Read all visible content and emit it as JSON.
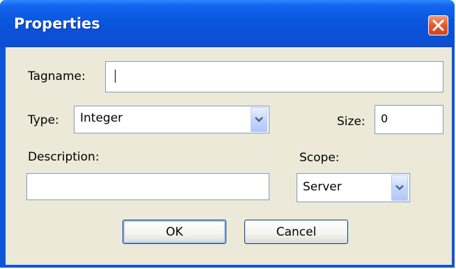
{
  "window": {
    "title": "Properties"
  },
  "fields": {
    "tagname_label": "Tagname:",
    "tagname_value": "",
    "type_label": "Type:",
    "type_value": "Integer",
    "size_label": "Size:",
    "size_value": "0",
    "description_label": "Description:",
    "description_value": "",
    "scope_label": "Scope:",
    "scope_value": "Server"
  },
  "buttons": {
    "ok": "OK",
    "cancel": "Cancel"
  },
  "icons": {
    "close": "close-icon",
    "dropdown": "chevron-down-icon"
  },
  "colors": {
    "titlebar": "#0a56de",
    "close": "#e2552b",
    "client_bg": "#ece9d8",
    "field_border": "#7f9db9"
  }
}
